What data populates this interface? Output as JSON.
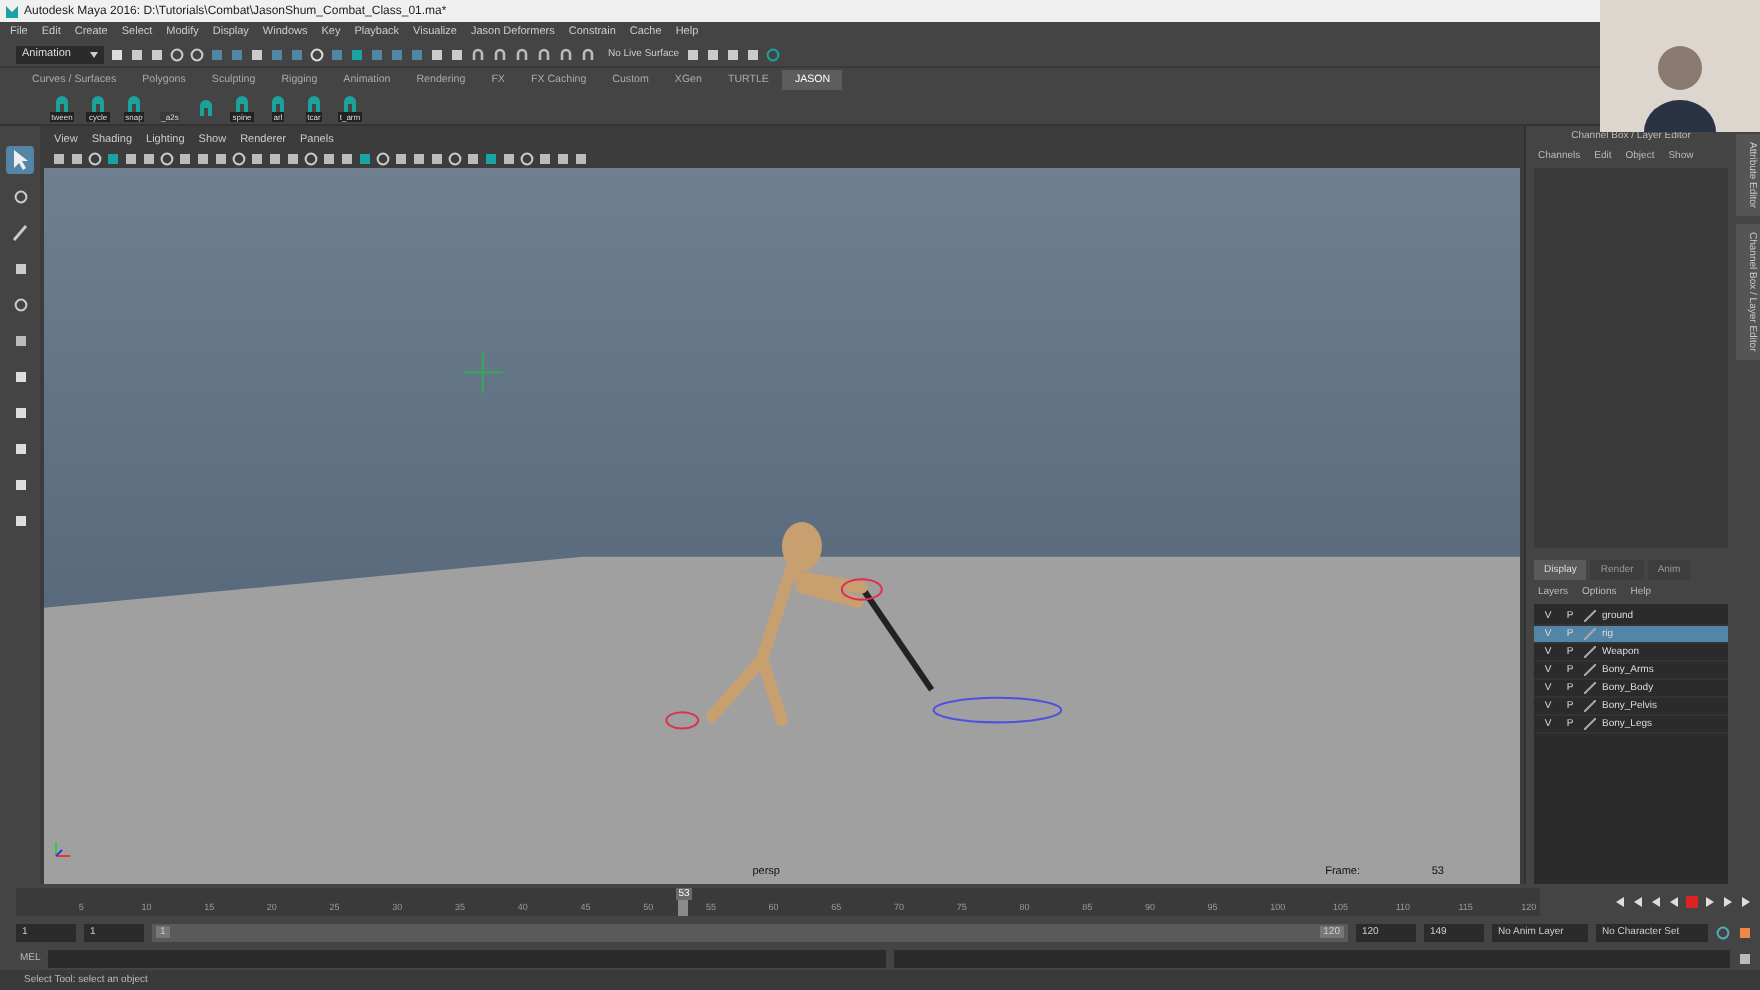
{
  "window": {
    "title": "Autodesk Maya 2016: D:\\Tutorials\\Combat\\JasonShum_Combat_Class_01.ma*"
  },
  "menu": [
    "File",
    "Edit",
    "Create",
    "Select",
    "Modify",
    "Display",
    "Windows",
    "Key",
    "Playback",
    "Visualize",
    "Jason Deformers",
    "Constrain",
    "Cache",
    "Help"
  ],
  "status_line": {
    "mode": "Animation",
    "live_surface": "No Live Surface"
  },
  "shelf_tabs": [
    {
      "label": "Curves / Surfaces",
      "selected": false
    },
    {
      "label": "Polygons",
      "selected": false
    },
    {
      "label": "Sculpting",
      "selected": false
    },
    {
      "label": "Rigging",
      "selected": false
    },
    {
      "label": "Animation",
      "selected": false
    },
    {
      "label": "Rendering",
      "selected": false
    },
    {
      "label": "FX",
      "selected": false
    },
    {
      "label": "FX Caching",
      "selected": false
    },
    {
      "label": "Custom",
      "selected": false
    },
    {
      "label": "XGen",
      "selected": false
    },
    {
      "label": "TURTLE",
      "selected": false
    },
    {
      "label": "JASON",
      "selected": true
    }
  ],
  "shelf_items": [
    {
      "kind": "tool",
      "label": "tween"
    },
    {
      "kind": "tool",
      "label": "cycle"
    },
    {
      "kind": "tool",
      "label": "snap"
    },
    {
      "kind": "script",
      "label": "_a2s"
    },
    {
      "kind": "icon"
    },
    {
      "kind": "tool",
      "label": "spine"
    },
    {
      "kind": "tool",
      "label": "arl"
    },
    {
      "kind": "tool",
      "label": "tcar"
    },
    {
      "kind": "tool",
      "label": "t_arm"
    }
  ],
  "viewport": {
    "menu": [
      "View",
      "Shading",
      "Lighting",
      "Show",
      "Renderer",
      "Panels"
    ],
    "camera": "persp",
    "frame_label": "Frame:",
    "frame": "53"
  },
  "channel_box": {
    "title": "Channel Box / Layer Editor",
    "menu": [
      "Channels",
      "Edit",
      "Object",
      "Show"
    ]
  },
  "side_tabs": [
    "Attribute Editor",
    "Channel Box / Layer Editor"
  ],
  "layer_editor": {
    "tabs": [
      {
        "label": "Display",
        "selected": true
      },
      {
        "label": "Render",
        "selected": false
      },
      {
        "label": "Anim",
        "selected": false
      }
    ],
    "menu": [
      "Layers",
      "Options",
      "Help"
    ],
    "layers": [
      {
        "visible": "V",
        "playback": "P",
        "name": "ground",
        "selected": false
      },
      {
        "visible": "V",
        "playback": "P",
        "name": "rig",
        "selected": true
      },
      {
        "visible": "V",
        "playback": "P",
        "name": "Weapon",
        "selected": false
      },
      {
        "visible": "V",
        "playback": "P",
        "name": "Bony_Arms",
        "selected": false
      },
      {
        "visible": "V",
        "playback": "P",
        "name": "Bony_Body",
        "selected": false
      },
      {
        "visible": "V",
        "playback": "P",
        "name": "Bony_Pelvis",
        "selected": false
      },
      {
        "visible": "V",
        "playback": "P",
        "name": "Bony_Legs",
        "selected": false
      }
    ]
  },
  "timeline": {
    "labels": [
      "5",
      "10",
      "15",
      "20",
      "25",
      "30",
      "35",
      "40",
      "45",
      "50",
      "55",
      "60",
      "65",
      "70",
      "75",
      "80",
      "85",
      "90",
      "95",
      "100",
      "105",
      "110",
      "115",
      "120"
    ],
    "current": "53",
    "level": 0.435
  },
  "range": {
    "level": 1,
    "start": "1",
    "playback_start": "1",
    "range_start": "1",
    "range_end": "120",
    "playback_end": "120",
    "end": "149",
    "anim_layer": "No Anim Layer",
    "character_set": "No Character Set"
  },
  "command_line": {
    "language": "MEL"
  },
  "help_line": "Select Tool: select an object"
}
